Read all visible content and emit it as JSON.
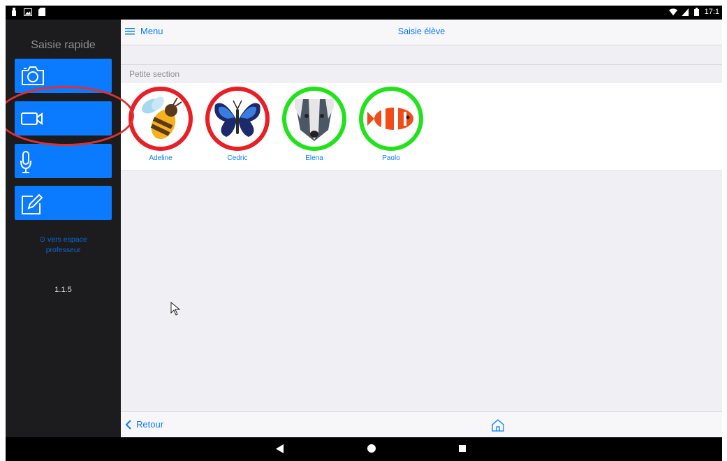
{
  "status_bar": {
    "left_icons": [
      "notification-icon",
      "image-icon",
      "sd-card-icon"
    ],
    "right_icons": [
      "wifi-icon",
      "signal-icon",
      "battery-icon"
    ],
    "time": "17:1"
  },
  "sidebar": {
    "title": "Saisie rapide",
    "buttons": [
      {
        "icon": "camera-icon"
      },
      {
        "icon": "video-icon"
      },
      {
        "icon": "microphone-icon"
      },
      {
        "icon": "edit-note-icon"
      }
    ],
    "link_text": "⊙ vers espace professeur",
    "version": "1.1.5"
  },
  "header": {
    "menu_label": "Menu",
    "title": "Saisie élève"
  },
  "section": {
    "title": "Petite section"
  },
  "students": [
    {
      "name": "Adeline",
      "animal": "bee",
      "status_color": "#e81f25"
    },
    {
      "name": "Cedric",
      "animal": "butterfly",
      "status_color": "#e81f25"
    },
    {
      "name": "Elena",
      "animal": "badger",
      "status_color": "#22e31b"
    },
    {
      "name": "Paolo",
      "animal": "clownfish",
      "status_color": "#22e31b"
    }
  ],
  "footer": {
    "back_label": "Retour",
    "home_icon": "home-icon"
  },
  "colors": {
    "accent": "#0a7aff",
    "sidebar_bg": "#1c1c1e",
    "highlight": "#e0302f"
  }
}
